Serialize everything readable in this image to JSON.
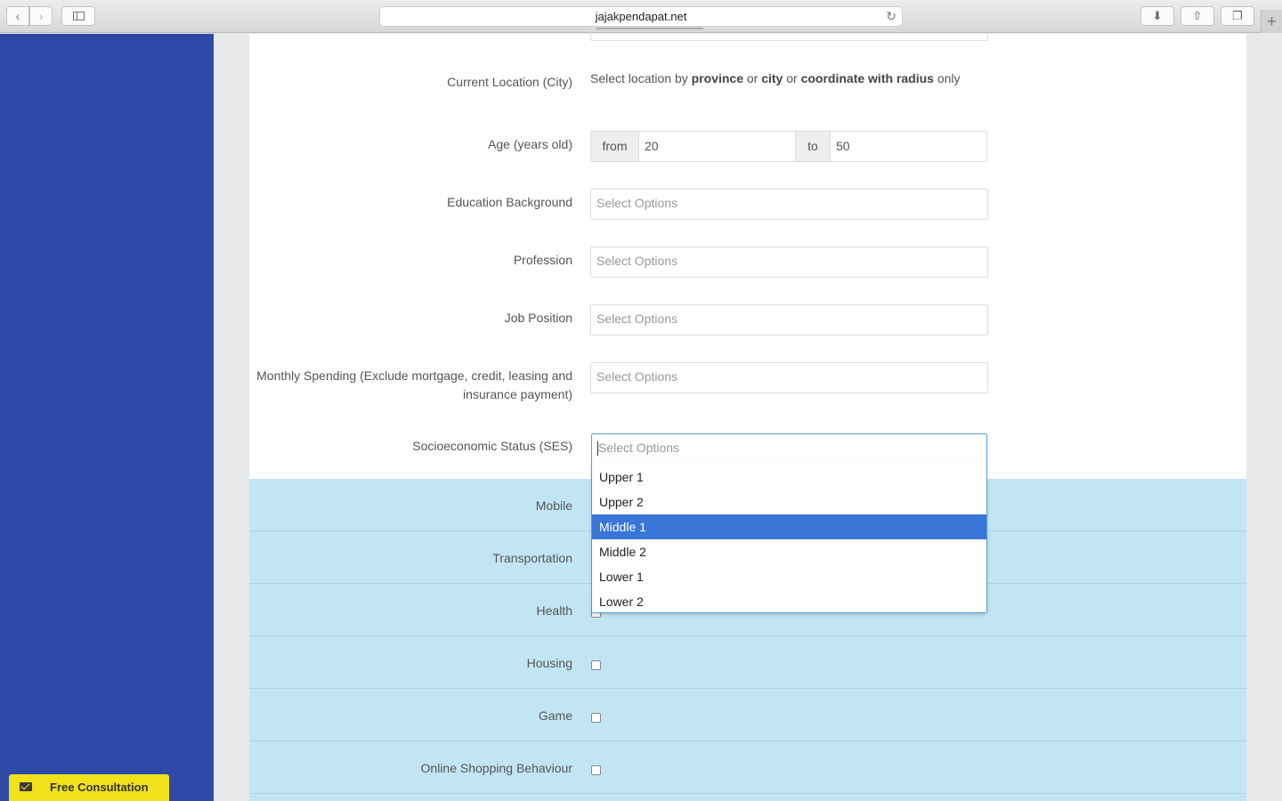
{
  "browser": {
    "url": "jajakpendapat.net"
  },
  "sidebar": {
    "consult_label": "Free Consultation"
  },
  "form": {
    "location": {
      "label": "Current Location (City)",
      "text_prefix": "Select location by",
      "province": "province",
      "or1": "or",
      "city": "city",
      "or2": "or",
      "coord": "coordinate with radius",
      "suffix": "only"
    },
    "age": {
      "label": "Age (years old)",
      "from_label": "from",
      "from_value": "20",
      "to_label": "to",
      "to_value": "50"
    },
    "education": {
      "label": "Education Background",
      "placeholder": "Select Options"
    },
    "profession": {
      "label": "Profession",
      "placeholder": "Select Options"
    },
    "job": {
      "label": "Job Position",
      "placeholder": "Select Options"
    },
    "spending": {
      "label_line1": "Monthly Spending (Exclude mortgage, credit, leasing and",
      "label_line2": "insurance payment)",
      "placeholder": "Select Options"
    },
    "ses": {
      "label": "Socioeconomic Status (SES)",
      "placeholder": "Select Options",
      "options": [
        "Upper 1",
        "Upper 2",
        "Middle 1",
        "Middle 2",
        "Lower 1",
        "Lower 2"
      ],
      "highlighted": "Middle 1"
    },
    "interests": [
      "Mobile",
      "Transportation",
      "Health",
      "Housing",
      "Game",
      "Online Shopping Behaviour"
    ]
  },
  "colors": {
    "sidebar": "#2e4aa8",
    "interest_band": "#c2e5f4",
    "highlight": "#3875d7",
    "consult_button": "#f0e11a"
  }
}
